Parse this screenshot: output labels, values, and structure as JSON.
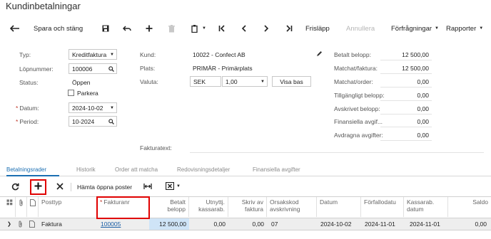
{
  "page": {
    "title": "Kundinbetalningar"
  },
  "toolbar": {
    "save_close": "Spara och stäng",
    "release": "Frisläpp",
    "cancel": "Annullera",
    "inquiries": "Förfrågningar",
    "reports": "Rapporter"
  },
  "form": {
    "type_label": "Typ:",
    "type_value": "Kreditfaktura",
    "number_label": "Löpnummer:",
    "number_value": "100006",
    "status_label": "Status:",
    "status_value": "Öppen",
    "hold_label": "Parkera",
    "date_label": "Datum:",
    "date_value": "2024-10-02",
    "period_label": "Period:",
    "period_value": "10-2024",
    "customer_label": "Kund:",
    "customer_value": "10022 - Confect AB",
    "location_label": "Plats:",
    "location_value": "PRIMÄR - Primärplats",
    "currency_label": "Valuta:",
    "currency_code": "SEK",
    "currency_rate": "1,00",
    "show_rate_button": "Visa bas",
    "invoice_text_label": "Fakturatext:",
    "invoice_text_value": ""
  },
  "summary": [
    {
      "label": "Betalt belopp:",
      "value": "12 500,00"
    },
    {
      "label": "Matchat/faktura:",
      "value": "12 500,00"
    },
    {
      "label": "Matchat/order:",
      "value": "0,00"
    },
    {
      "label": "Tillgängligt belopp:",
      "value": "0,00"
    },
    {
      "label": "Avskrivet belopp:",
      "value": "0,00"
    },
    {
      "label": "Finansiella avgif...",
      "value": "0,00"
    },
    {
      "label": "Avdragna avgifter:",
      "value": "0,00"
    }
  ],
  "tabs": [
    {
      "label": "Betalningsrader"
    },
    {
      "label": "Historik"
    },
    {
      "label": "Order att matcha"
    },
    {
      "label": "Redovisningsdetaljer"
    },
    {
      "label": "Finansiella avgifter"
    }
  ],
  "grid_toolbar": {
    "load_open": "Hämta öppna poster"
  },
  "grid": {
    "headers": {
      "doc_type": "Posttyp",
      "ref_nbr": "Fakturanr",
      "amount_paid_1": "Betalt",
      "amount_paid_2": "belopp",
      "cash_disc_1": "Utnyttj.",
      "cash_disc_2": "kassarab.",
      "writeoff_1": "Skriv av",
      "writeoff_2": "faktura",
      "reason_1": "Orsakskod",
      "reason_2": "avskrivning",
      "date": "Datum",
      "due_date": "Förfallodatu",
      "cash_disc_date_1": "Kassarab.",
      "cash_disc_date_2": "datum",
      "balance": "Saldo"
    },
    "row": {
      "doc_type": "Faktura",
      "ref_nbr": "100005",
      "amount_paid": "12 500,00",
      "cash_disc": "0,00",
      "writeoff": "0,00",
      "reason": "07",
      "date": "2024-10-02",
      "due_date": "2024-11-01",
      "cash_disc_date": "2024-11-01",
      "balance": "0,00"
    }
  }
}
